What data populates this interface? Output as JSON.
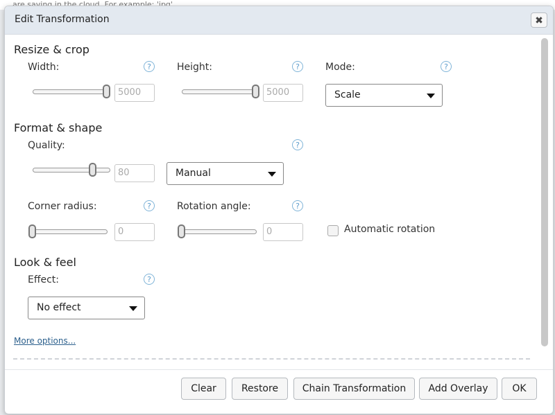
{
  "background": {
    "partial_text": "are saving in the cloud. For example: 'jpg'"
  },
  "dialog": {
    "title": "Edit Transformation",
    "close_label": "✖",
    "help_label": "?"
  },
  "resize": {
    "section_title": "Resize & crop",
    "width": {
      "label": "Width:",
      "placeholder": "5000",
      "slider_fraction": 1.0
    },
    "height": {
      "label": "Height:",
      "placeholder": "5000",
      "slider_fraction": 1.0
    },
    "mode": {
      "label": "Mode:",
      "value": "Scale"
    }
  },
  "format": {
    "section_title": "Format & shape",
    "quality": {
      "label": "Quality:",
      "placeholder": "80",
      "slider_fraction": 0.8,
      "mode_value": "Manual"
    },
    "corner_radius": {
      "label": "Corner radius:",
      "placeholder": "0",
      "slider_fraction": 0.0
    },
    "rotation_angle": {
      "label": "Rotation angle:",
      "placeholder": "0",
      "slider_fraction": 0.0
    },
    "automatic_rotation": {
      "label": "Automatic rotation",
      "checked": false
    }
  },
  "look": {
    "section_title": "Look & feel",
    "effect": {
      "label": "Effect:",
      "value": "No effect"
    }
  },
  "more_options_label": "More options...",
  "footer": {
    "clear": "Clear",
    "restore": "Restore",
    "chain": "Chain Transformation",
    "add_overlay": "Add Overlay",
    "ok": "OK"
  }
}
